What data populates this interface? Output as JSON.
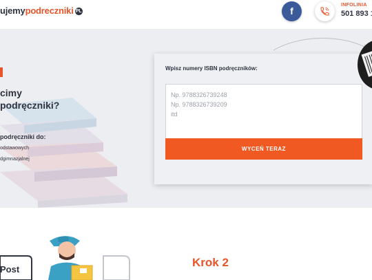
{
  "header": {
    "logo_prefix": "ujemy",
    "logo_accent": "podreczniki",
    "logo_badge": "PL",
    "facebook_label": "f",
    "infoline_label": "INFOLINIA",
    "infoline_number": "501 893 1"
  },
  "hero": {
    "title_line1": "cimy",
    "title_line2": "podręczniki?",
    "subtitle": "podręczniki do:",
    "items": [
      "odstawowych",
      "dgimnazjalnej"
    ]
  },
  "isbn_form": {
    "label": "Wpisz numery ISBN podręczników:",
    "placeholder": "Np. 9788326739248\nNp. 9788326739209\nitd",
    "value": "",
    "submit_label": "WYCEŃ TERAZ"
  },
  "steps": {
    "step_title": "Krok 2",
    "courier_label": "Post"
  },
  "colors": {
    "accent": "#e8542a",
    "button": "#f05a22",
    "facebook": "#3b5a9a",
    "text_dark": "#2f3340",
    "hero_bg": "#eceef2"
  },
  "icons": [
    "facebook-icon",
    "phone-icon",
    "barcode-scanner-icon"
  ]
}
